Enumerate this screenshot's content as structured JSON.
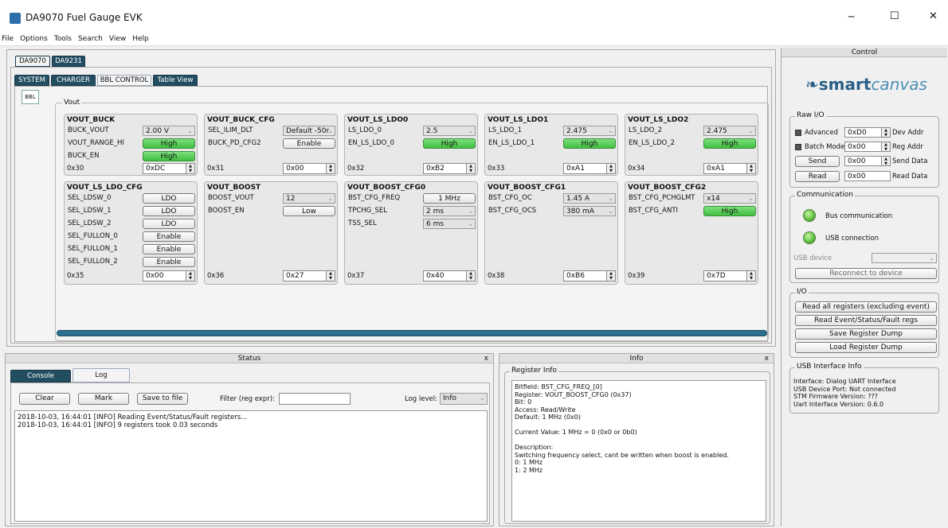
{
  "window": {
    "title": "DA9070 Fuel Gauge EVK",
    "minimize": "─",
    "maximize": "☐",
    "close": "✕"
  },
  "menu": [
    "File",
    "Options",
    "Tools",
    "Search",
    "View",
    "Help"
  ],
  "chip_tabs": [
    "DA9070",
    "DA9231"
  ],
  "sub_tabs": [
    "SYSTEM",
    "CHARGER",
    "BBL CONTROL",
    "Table View"
  ],
  "side_tab": "BBL",
  "vout_group": "Vout",
  "regs": {
    "vout_buck": {
      "title": "VOUT_BUCK",
      "r1_label": "BUCK_VOUT",
      "r1_value": "2.00 V",
      "r2_label": "VOUT_RANGE_HI",
      "r2_value": "High",
      "r3_label": "BUCK_EN",
      "r3_value": "High",
      "addr": "0x30",
      "hex": "0xDC"
    },
    "vout_buck_cfg": {
      "title": "VOUT_BUCK_CFG",
      "r1_label": "SEL_ILIM_DLT",
      "r1_value": "Default -50r",
      "r2_label": "BUCK_PD_CFG2",
      "r2_value": "Enable",
      "addr": "0x31",
      "hex": "0x00"
    },
    "vout_ls_ldo0": {
      "title": "VOUT_LS_LDO0",
      "r1_label": "LS_LDO_0",
      "r1_value": "2.5",
      "r2_label": "EN_LS_LDO_0",
      "r2_value": "High",
      "addr": "0x32",
      "hex": "0xB2"
    },
    "vout_ls_ldo1": {
      "title": "VOUT_LS_LDO1",
      "r1_label": "LS_LDO_1",
      "r1_value": "2.475",
      "r2_label": "EN_LS_LDO_1",
      "r2_value": "High",
      "addr": "0x33",
      "hex": "0xA1"
    },
    "vout_ls_ldo2": {
      "title": "VOUT_LS_LDO2",
      "r1_label": "LS_LDO_2",
      "r1_value": "2.475",
      "r2_label": "EN_LS_LDO_2",
      "r2_value": "High",
      "addr": "0x34",
      "hex": "0xA1"
    },
    "vout_ls_ldo_cfg": {
      "title": "VOUT_LS_LDO_CFG",
      "rows": [
        {
          "label": "SEL_LDSW_0",
          "value": "LDO"
        },
        {
          "label": "SEL_LDSW_1",
          "value": "LDO"
        },
        {
          "label": "SEL_LDSW_2",
          "value": "LDO"
        },
        {
          "label": "SEL_FULLON_0",
          "value": "Enable"
        },
        {
          "label": "SEL_FULLON_1",
          "value": "Enable"
        },
        {
          "label": "SEL_FULLON_2",
          "value": "Enable"
        }
      ],
      "addr": "0x35",
      "hex": "0x00"
    },
    "vout_boost": {
      "title": "VOUT_BOOST",
      "r1_label": "BOOST_VOUT",
      "r1_value": "12",
      "r2_label": "BOOST_EN",
      "r2_value": "Low",
      "addr": "0x36",
      "hex": "0x27"
    },
    "vout_boost_cfg0": {
      "title": "VOUT_BOOST_CFG0",
      "r1_label": "BST_CFG_FREQ",
      "r1_value": "1 MHz",
      "r2_label": "TPCHG_SEL",
      "r2_value": "2 ms",
      "r3_label": "TSS_SEL",
      "r3_value": "6 ms",
      "addr": "0x37",
      "hex": "0x40"
    },
    "vout_boost_cfg1": {
      "title": "VOUT_BOOST_CFG1",
      "r1_label": "BST_CFG_OC",
      "r1_value": "1.45 A",
      "r2_label": "BST_CFG_OCS",
      "r2_value": "380 mA",
      "addr": "0x38",
      "hex": "0xB6"
    },
    "vout_boost_cfg2": {
      "title": "VOUT_BOOST_CFG2",
      "r1_label": "BST_CFG_PCHGLMT",
      "r1_value": "x14",
      "r2_label": "BST_CFG_ANTI",
      "r2_value": "High",
      "addr": "0x39",
      "hex": "0x7D"
    }
  },
  "status": {
    "title": "Status",
    "tabs": [
      "Console",
      "Log"
    ],
    "clear": "Clear",
    "mark": "Mark",
    "save": "Save to file",
    "filter_label": "Filter (reg expr):",
    "filter_value": "",
    "loglevel_label": "Log level:",
    "loglevel_value": "Info",
    "log_lines": [
      "2018-10-03, 16:44:01 [INFO] Reading Event/Status/Fault registers...",
      "2018-10-03, 16:44:01 [INFO] 9 registers took 0.03 seconds"
    ]
  },
  "info": {
    "title": "Info",
    "group": "Register Info",
    "lines": [
      "Bitfield: BST_CFG_FREQ_[0]",
      "Register: VOUT_BOOST_CFG0 (0x37)",
      "Bit: 0",
      "Access: Read/Write",
      "Default: 1 MHz (0x0)",
      "",
      "Current Value: 1 MHz = 0 (0x0 or 0b0)",
      "",
      "Description:",
      "Switching frequency select, cant be written when boost is enabled.",
      "0: 1 MHz",
      "1: 2 MHz"
    ]
  },
  "control": {
    "title": "Control",
    "logo_smart": "smart",
    "logo_canvas": "canvas",
    "rawio": {
      "title": "Raw I/O",
      "advanced": "Advanced",
      "dev_addr_value": "0xD0",
      "dev_addr_label": "Dev Addr",
      "batch": "Batch Mode",
      "reg_addr_value": "0x00",
      "reg_addr_label": "Reg Addr",
      "send": "Send",
      "send_value": "0x00",
      "send_label": "Send Data",
      "read": "Read",
      "read_value": "0x00",
      "read_label": "Read Data"
    },
    "comm": {
      "title": "Communication",
      "bus": "Bus communication",
      "usb": "USB connection",
      "usb_device": "USB device",
      "usb_device_value": "",
      "reconnect": "Reconnect to device"
    },
    "io": {
      "title": "I/O",
      "b1": "Read all registers (excluding event)",
      "b2": "Read Event/Status/Fault regs",
      "b3": "Save Register Dump",
      "b4": "Load Register Dump"
    },
    "usbinfo": {
      "title": "USB Interface Info",
      "lines": [
        "Interface: Dialog UART Interface",
        "USB Device Port: Not connected",
        "STM Firmware Version: ???",
        "Uart Interface Version: 0.6.0"
      ]
    }
  }
}
